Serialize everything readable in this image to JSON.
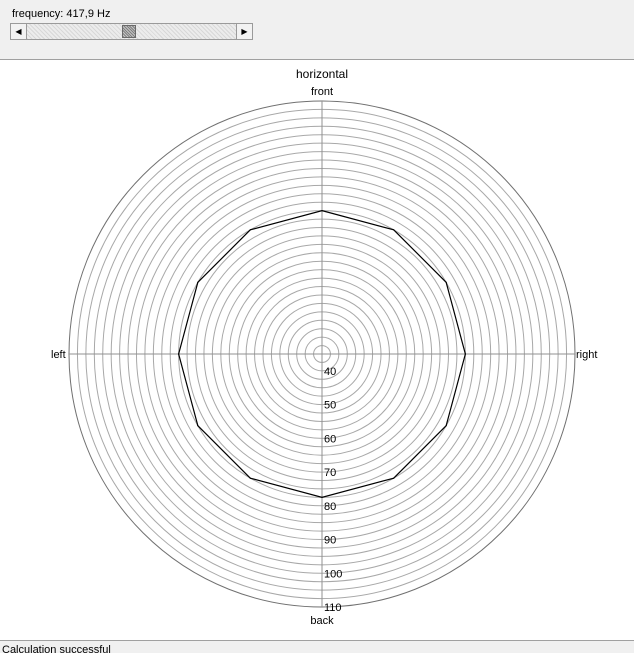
{
  "header": {
    "frequency_label": "frequency: 417,9 Hz",
    "slider_position": 0.49
  },
  "chart_data": {
    "type": "polar",
    "title": "horizontal",
    "directions": {
      "front": "front",
      "right": "right",
      "back": "back",
      "left": "left"
    },
    "radial_axis": {
      "min": 35,
      "max": 110,
      "ring_step": 2.5,
      "tick_labels": [
        "40",
        "50",
        "60",
        "70",
        "80",
        "90",
        "100",
        "110"
      ]
    },
    "series": [
      {
        "angles_deg": [
          0,
          30,
          60,
          90,
          120,
          150,
          180,
          210,
          240,
          270,
          300,
          330
        ],
        "values": [
          77.5,
          77.5,
          77.5,
          77.5,
          77.5,
          77.5,
          77.5,
          77.5,
          77.5,
          77.5,
          77.5,
          77.5
        ],
        "color": "#000000"
      }
    ],
    "grid": true
  },
  "status": {
    "text": "Calculation successful"
  }
}
